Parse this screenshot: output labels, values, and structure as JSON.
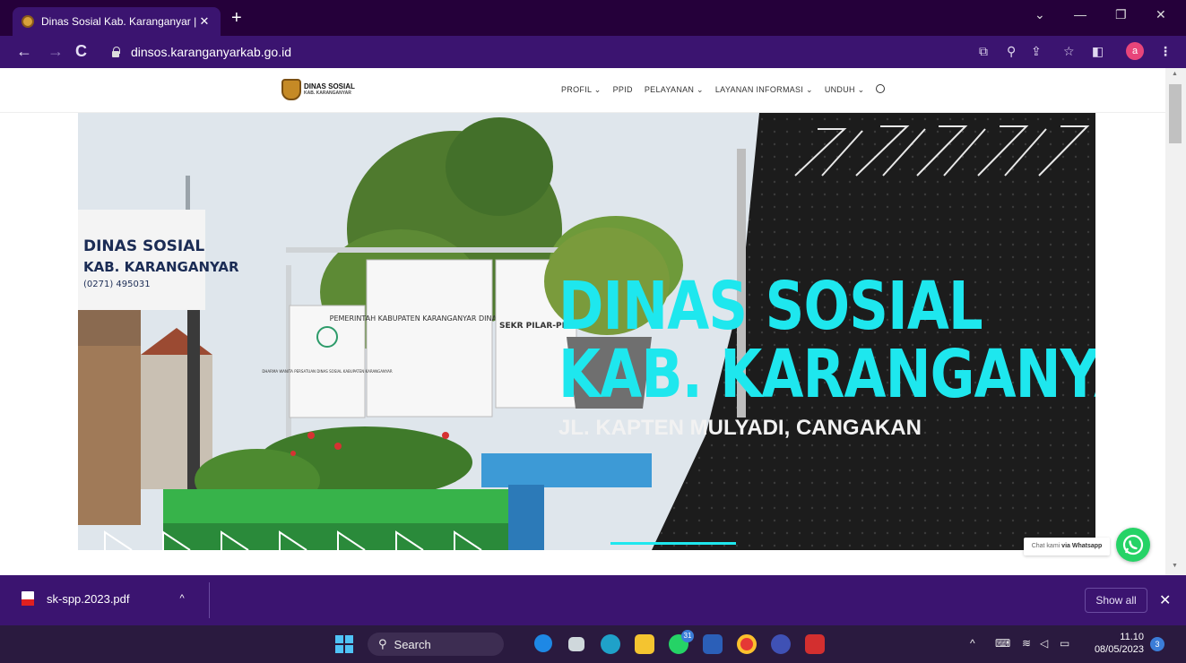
{
  "browser": {
    "tab_title": "Dinas Sosial Kab. Karanganyar | T",
    "tab_close": "✕",
    "new_tab": "+",
    "url": "dinsos.karanganyarkab.go.id",
    "profile_initial": "a"
  },
  "site": {
    "logo_line1": "DINAS SOSIAL",
    "logo_line2": "KAB. KARANGANYAR",
    "nav": {
      "profil": "PROFIL ⌄",
      "ppid": "PPID",
      "pelayanan": "PELAYANAN ⌄",
      "layanan_informasi": "LAYANAN INFORMASI ⌄",
      "unduh": "UNDUH ⌄"
    },
    "hero": {
      "title_line1": "DINAS SOSIAL",
      "title_line2": "KAB. KARANGANYAR",
      "subtitle": "JL. KAPTEN MULYADI, CANGAKAN",
      "sign1": "DINAS SOSIAL",
      "sign2": "KAB. KARANGANYAR",
      "sign3": "(0271) 495031",
      "board1": "PEMERINTAH KABUPATEN KARANGANYAR DINAS SOSIAL",
      "board2": "DHARMA WANITA PERSATUAN DINAS SOSIAL KABUPATEN KARANGANYAR",
      "board3": "SEKR PILAR-PI"
    },
    "whatsapp_label_prefix": "Chat kami ",
    "whatsapp_label_bold": "via Whatsapp"
  },
  "download": {
    "filename": "sk-spp.2023.pdf",
    "show_all": "Show all"
  },
  "taskbar": {
    "search": "Search",
    "time": "11.10",
    "date": "08/05/2023",
    "notifications": "3",
    "whatsapp_badge": "31"
  },
  "colors": {
    "chrome": "#3b1470",
    "tabbar": "#25003a",
    "hero_accent": "#1ee7ee",
    "whatsapp": "#25d366"
  }
}
